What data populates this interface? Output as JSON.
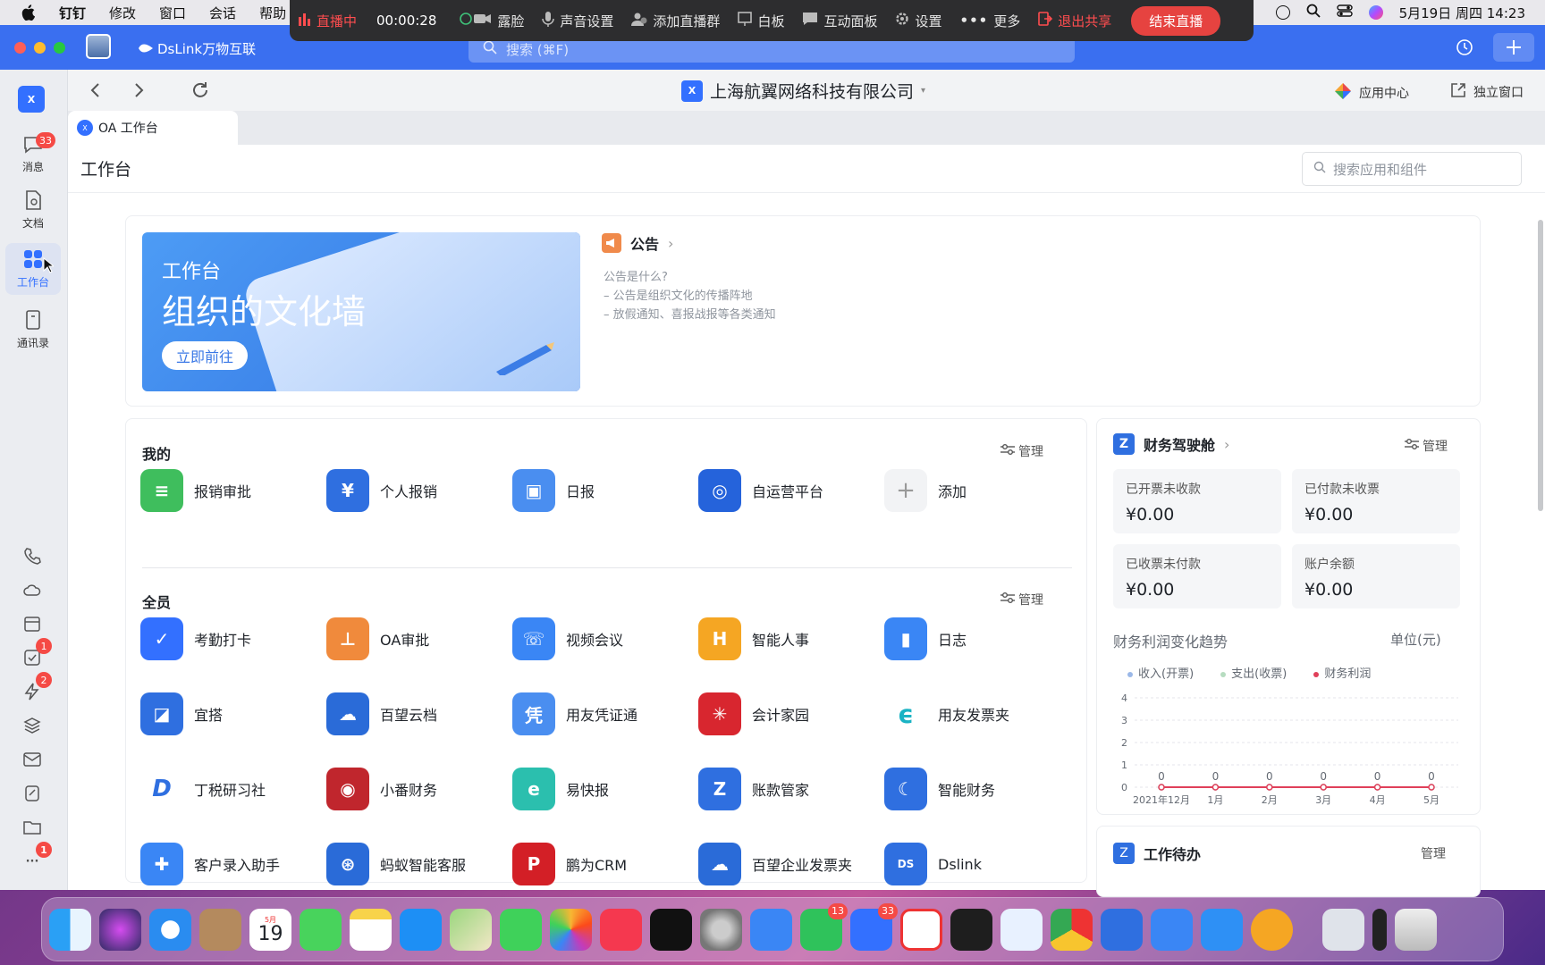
{
  "menubar": {
    "items": [
      "钉钉",
      "修改",
      "窗口",
      "会话",
      "帮助"
    ],
    "datetime": "5月19日 周四  14:23"
  },
  "live": {
    "status": "直播中",
    "time": "00:00:28",
    "beauty": "露脸",
    "sound": "声音设置",
    "add_group": "添加直播群",
    "whiteboard": "白板",
    "interactive": "互动面板",
    "settings": "设置",
    "more": "更多",
    "exit_share": "退出共享",
    "end": "结束直播"
  },
  "window": {
    "brand": "DsLink万物互联",
    "search_placeholder": "搜索 (⌘F)"
  },
  "sidebar": {
    "items": [
      {
        "label": "消息",
        "badge": "33"
      },
      {
        "label": "文档"
      },
      {
        "label": "工作台"
      },
      {
        "label": "通讯录"
      }
    ],
    "small_badges": [
      "1",
      "2",
      "1"
    ]
  },
  "nav": {
    "org": "上海航翼网络科技有限公司",
    "app_center": "应用中心",
    "standalone": "独立窗口"
  },
  "tab": {
    "label": "OA 工作台"
  },
  "page": {
    "title": "工作台",
    "search_placeholder": "搜索应用和组件"
  },
  "banner": {
    "line1": "工作台",
    "line2": "组织的文化墙",
    "button": "立即前往"
  },
  "notice": {
    "title": "公告",
    "lines": [
      "公告是什么?",
      "– 公告是组织文化的传播阵地",
      "– 放假通知、喜报战报等各类通知"
    ]
  },
  "mine": {
    "title": "我的",
    "manage": "管理",
    "apps": [
      "报销审批",
      "个人报销",
      "日报",
      "自运营平台",
      "添加"
    ]
  },
  "all": {
    "title": "全员",
    "manage": "管理",
    "apps": [
      "考勤打卡",
      "OA审批",
      "视频会议",
      "智能人事",
      "日志",
      "宜搭",
      "百望云档",
      "用友凭证通",
      "会计家园",
      "用友发票夹",
      "丁税研习社",
      "小番财务",
      "易快报",
      "账款管家",
      "智能财务",
      "客户录入助手",
      "蚂蚁智能客服",
      "鹏为CRM",
      "百望企业发票夹",
      "Dslink"
    ]
  },
  "finance": {
    "title": "财务驾驶舱",
    "manage": "管理",
    "cards": [
      {
        "label": "已开票未收款",
        "value": "¥0.00"
      },
      {
        "label": "已付款未收票",
        "value": "¥0.00"
      },
      {
        "label": "已收票未付款",
        "value": "¥0.00"
      },
      {
        "label": "账户余额",
        "value": "¥0.00"
      }
    ],
    "trend_title": "财务利润变化趋势",
    "unit": "单位(元)",
    "next_card": "工作待办",
    "next_manage": "管理"
  },
  "chart_data": {
    "type": "line",
    "categories": [
      "2021年12月",
      "1月",
      "2月",
      "3月",
      "4月",
      "5月"
    ],
    "series": [
      {
        "name": "收入(开票)",
        "values": [
          0,
          0,
          0,
          0,
          0,
          0
        ],
        "color": "#9bb8e8"
      },
      {
        "name": "支出(收票)",
        "values": [
          0,
          0,
          0,
          0,
          0,
          0
        ],
        "color": "#b6dcc0"
      },
      {
        "name": "财务利润",
        "values": [
          0,
          0,
          0,
          0,
          0,
          0
        ],
        "color": "#e0405a"
      }
    ],
    "point_labels": [
      "0",
      "0",
      "0",
      "0",
      "0",
      "0"
    ],
    "yticks": [
      "0",
      "1",
      "2",
      "3",
      "4"
    ],
    "ylim": [
      0,
      4
    ],
    "legend": "top",
    "grid": true
  },
  "dock": {
    "calendar_day": "19",
    "calendar_month": "5月",
    "badges": {
      "wechat": "13",
      "dingtalk": "33"
    }
  }
}
